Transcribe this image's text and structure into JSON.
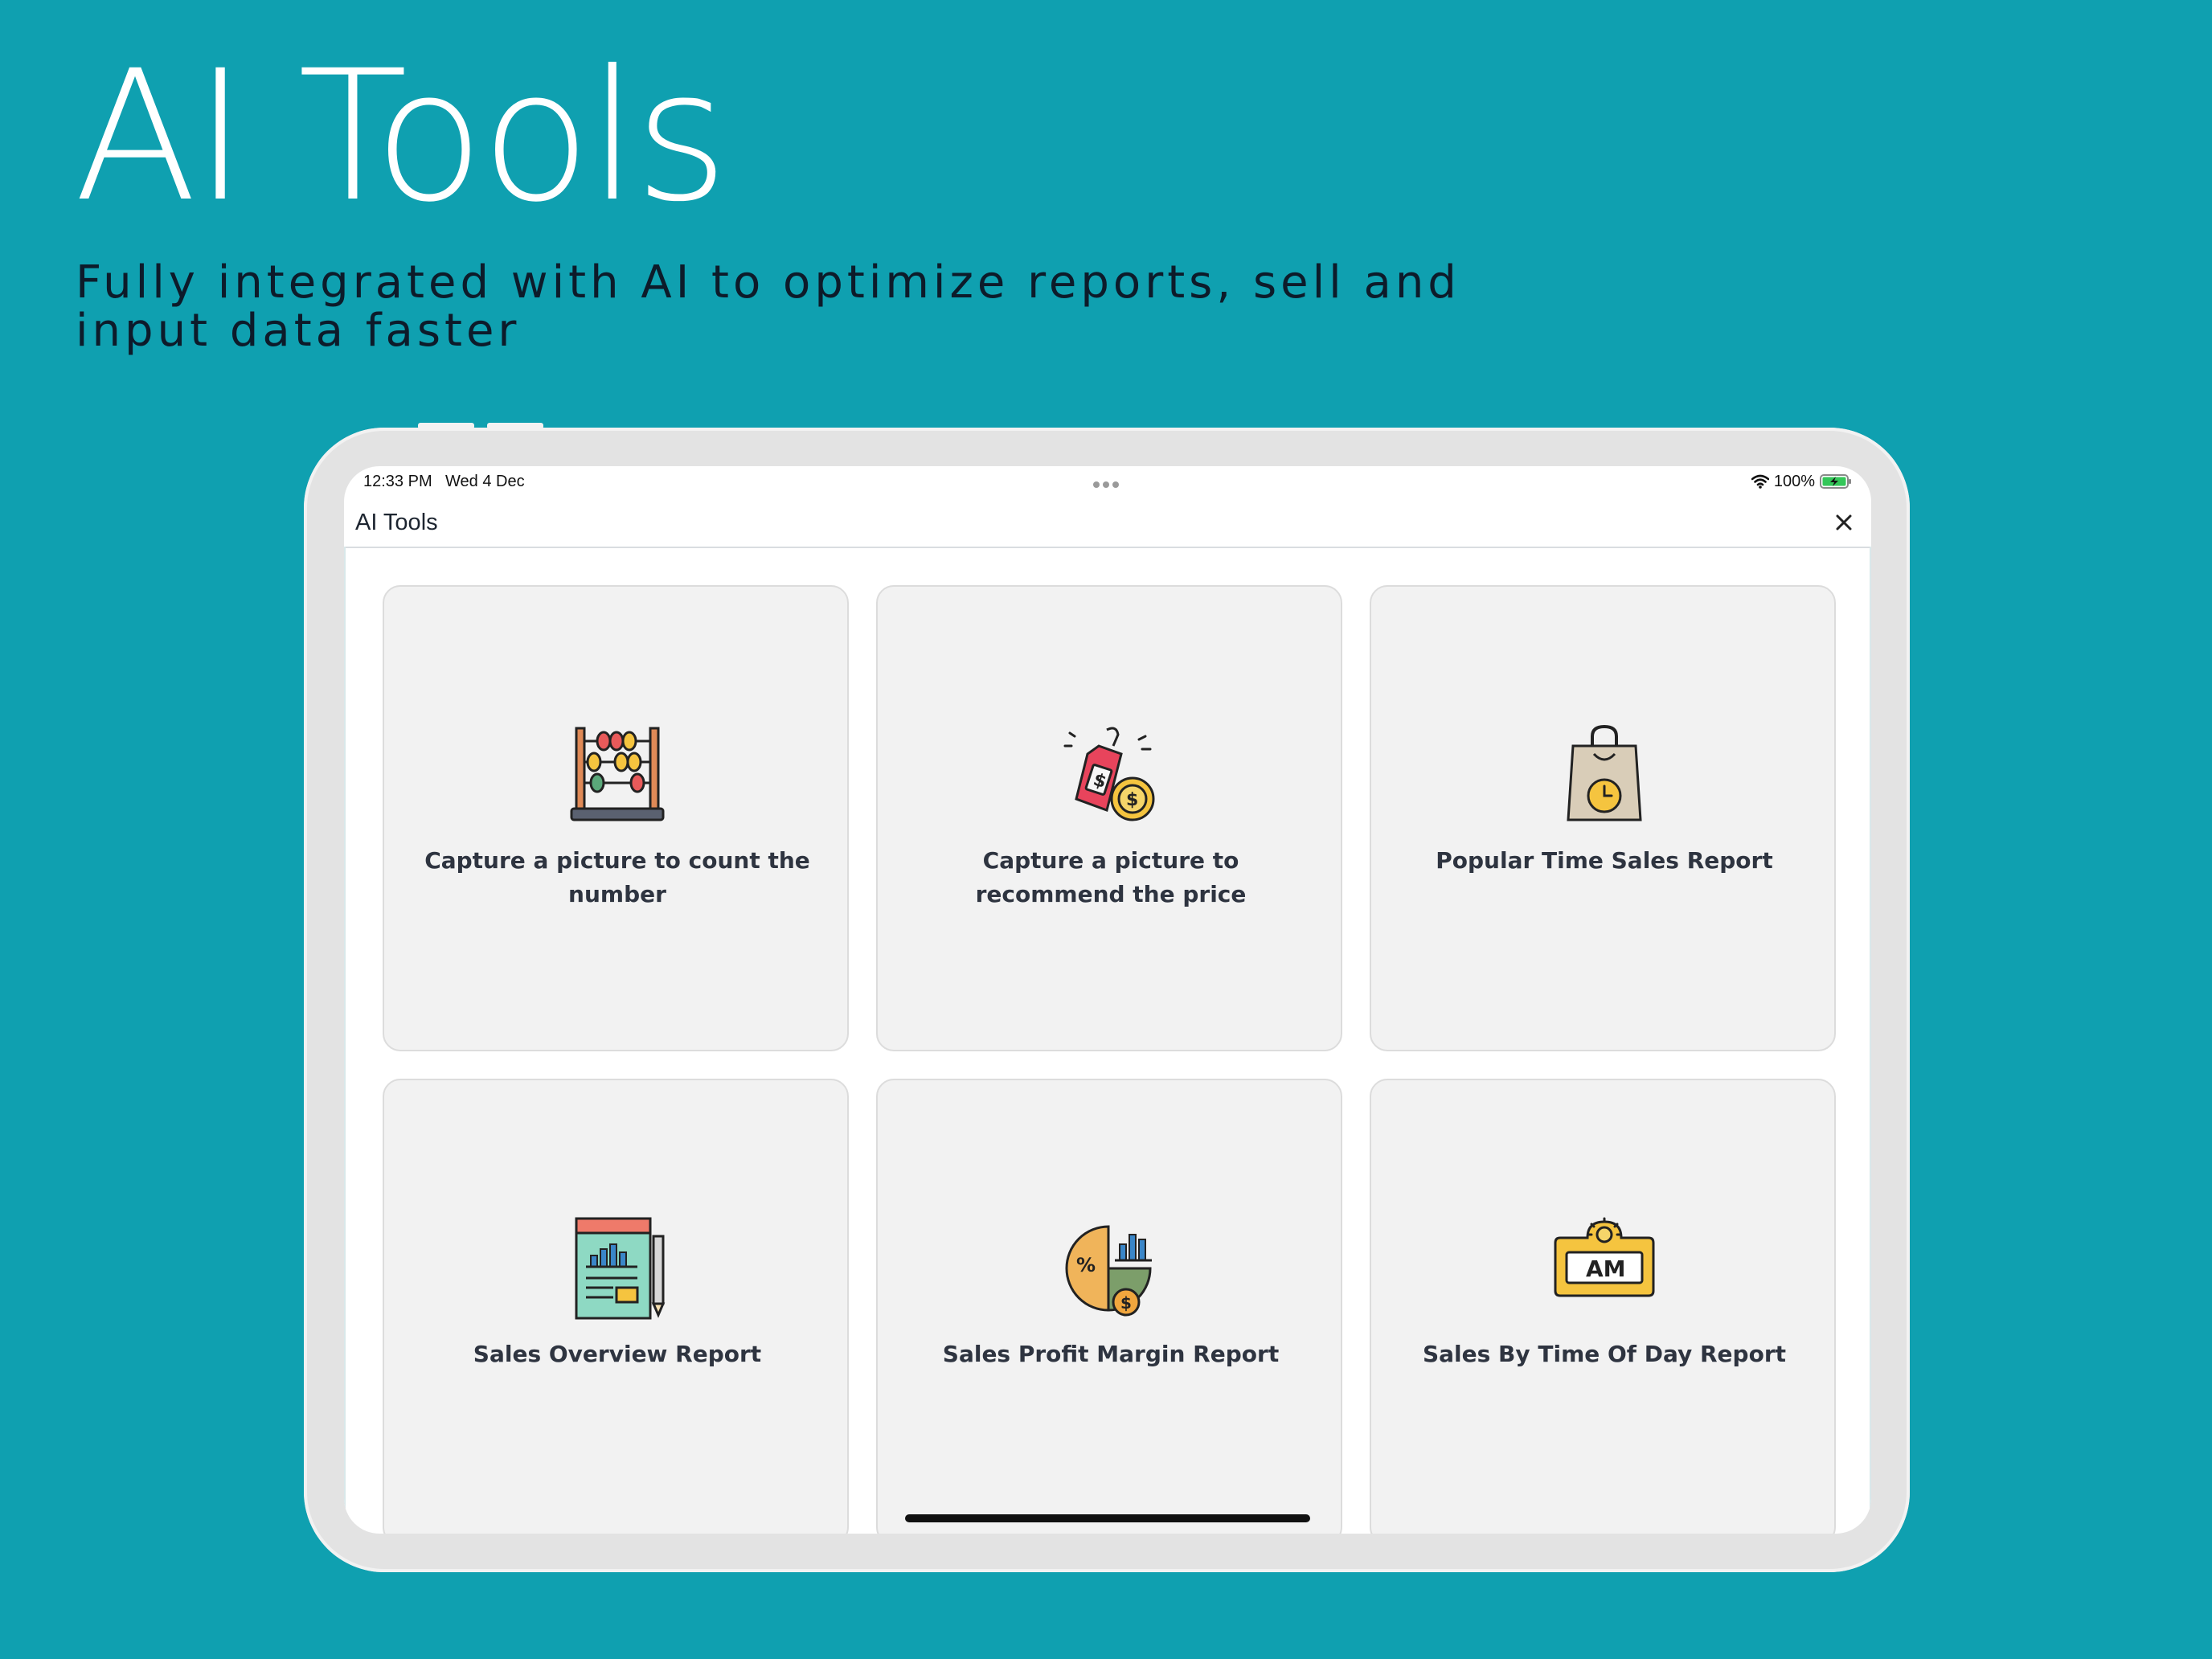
{
  "hero": {
    "title": "AI Tools",
    "subtitle": "Fully integrated with AI to optimize reports, sell and input data faster"
  },
  "status_bar": {
    "time": "12:33 PM",
    "date": "Wed 4 Dec",
    "battery": "100%",
    "icons": [
      "wifi-icon",
      "battery-charging-icon"
    ]
  },
  "header": {
    "title": "AI Tools",
    "close_icon": "close-icon"
  },
  "tools": [
    {
      "label": "Capture a picture to count the number",
      "icon": "abacus-icon"
    },
    {
      "label": "Capture a picture to recommend the price",
      "icon": "price-tag-icon"
    },
    {
      "label": "Popular Time Sales Report",
      "icon": "shopping-bag-clock-icon"
    },
    {
      "label": "Sales Overview Report",
      "icon": "report-document-icon"
    },
    {
      "label": "Sales Profit Margin Report",
      "icon": "profit-margin-chart-icon"
    },
    {
      "label": "Sales By Time Of Day Report",
      "icon": "am-sign-icon"
    }
  ],
  "colors": {
    "background": "#0fa0b0",
    "card": "#f2f2f2",
    "text_dark": "#2e3440"
  }
}
